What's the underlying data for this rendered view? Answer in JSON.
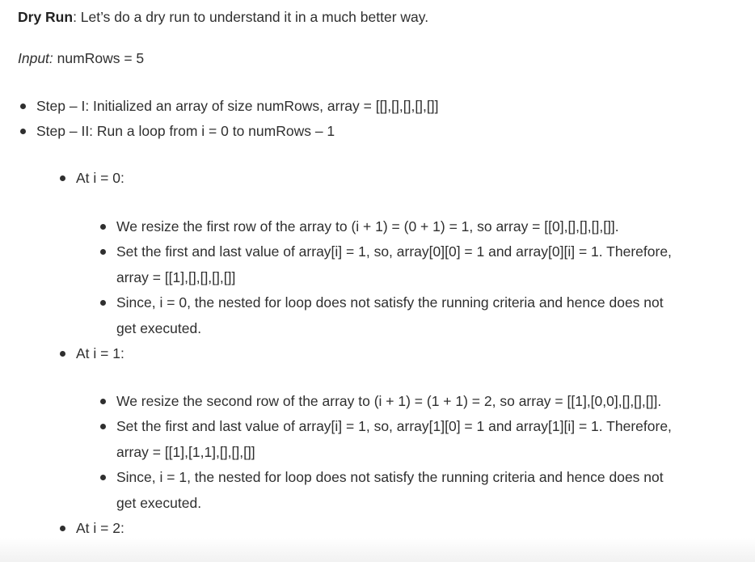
{
  "intro": {
    "label": "Dry Run",
    "text": ": Let’s do a dry run to understand it in a much better way."
  },
  "input": {
    "label": "Input:",
    "text": " numRows = 5"
  },
  "steps": [
    "Step – I: Initialized an array of size numRows, array = [[],[],[],[],[]]",
    "Step – II: Run a loop from i = 0 to numRows – 1"
  ],
  "iterations": [
    {
      "heading": "At i = 0:",
      "bullets": [
        "We resize the first row of the array to (i + 1) = (0 + 1) = 1, so array = [[0],[],[],[],[]].",
        "Set the first and last value of array[i] = 1, so, array[0][0] = 1 and array[0][i] = 1. Therefore, array = [[1],[],[],[],[]]",
        "Since, i = 0, the nested for loop does not satisfy the running criteria and hence does not get executed."
      ]
    },
    {
      "heading": "At i = 1:",
      "bullets": [
        "We resize the second row of the array to (i + 1) = (1 + 1) = 2, so array = [[1],[0,0],[],[],[]].",
        "Set the first and last value of array[i] = 1, so, array[1][0] = 1 and array[1][i] = 1. Therefore, array = [[1],[1,1],[],[],[]]",
        "Since, i = 1, the nested for loop does not satisfy the running criteria and hence does not get executed."
      ]
    },
    {
      "heading": "At i = 2:",
      "bullets": []
    }
  ]
}
